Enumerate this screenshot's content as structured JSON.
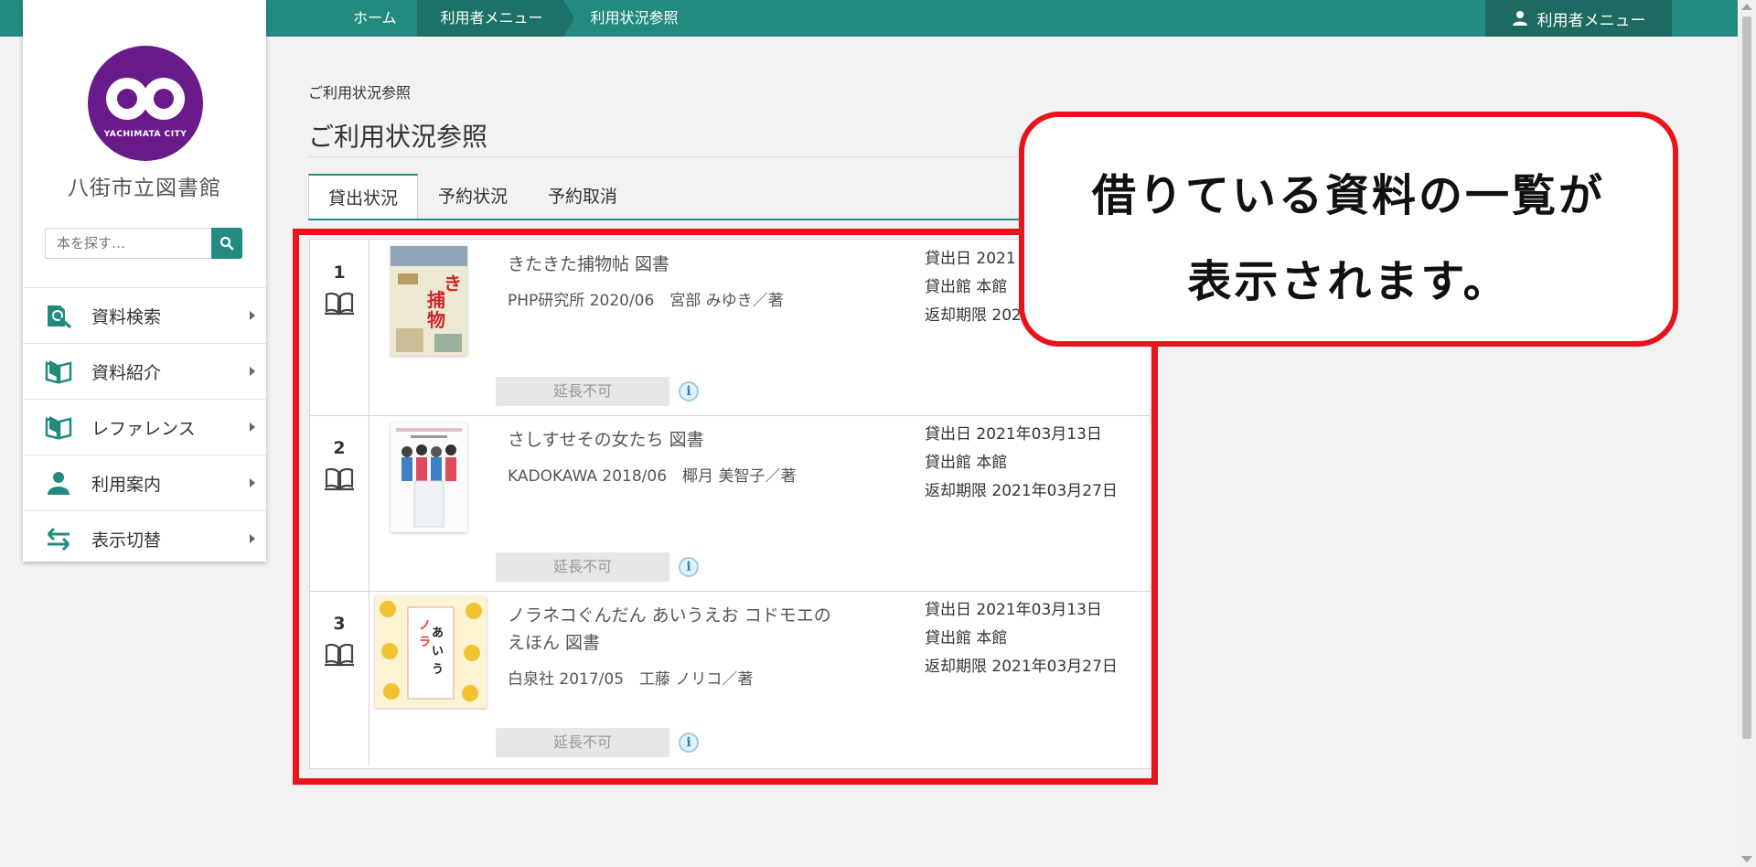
{
  "breadcrumb": [
    "ホーム",
    "利用者メニュー",
    "利用状況参照"
  ],
  "user_menu": {
    "label": "利用者メニュー",
    "icon": "user-icon"
  },
  "sidebar": {
    "logo_text": "YACHIMATA CITY",
    "library_name": "八街市立図書館",
    "search": {
      "placeholder": "本を探す…",
      "icon": "search-icon"
    },
    "items": [
      {
        "label": "資料検索",
        "icon": "book-search-icon"
      },
      {
        "label": "資料紹介",
        "icon": "open-book-icon"
      },
      {
        "label": "レファレンス",
        "icon": "open-book-icon"
      },
      {
        "label": "利用案内",
        "icon": "person-icon"
      },
      {
        "label": "表示切替",
        "icon": "switch-arrows-icon"
      }
    ]
  },
  "page": {
    "breadcrumb_small": "ご利用状況参照",
    "title": "ご利用状況参照",
    "tabs": [
      "貸出状況",
      "予約状況",
      "予約取消"
    ],
    "active_tab": "貸出状況"
  },
  "loans": [
    {
      "no": "1",
      "title": "きたきた捕物帖 図書",
      "meta": "PHP研究所 2020/06　宮部 みゆき／著",
      "loan_date": "貸出日 2021",
      "branch": "貸出館 本館",
      "due": "返却期限 202",
      "button": "延長不可",
      "info": "i"
    },
    {
      "no": "2",
      "title": "さしすせその女たち 図書",
      "meta": "KADOKAWA 2018/06　椰月 美智子／著",
      "loan_date": "貸出日 2021年03月13日",
      "branch": "貸出館 本館",
      "due": "返却期限 2021年03月27日",
      "button": "延長不可",
      "info": "i"
    },
    {
      "no": "3",
      "title_line1": "ノラネコぐんだん あいうえお コドモエの",
      "title_line2": "えほん 図書",
      "meta": "白泉社 2017/05　工藤 ノリコ／著",
      "loan_date": "貸出日 2021年03月13日",
      "branch": "貸出館 本館",
      "due": "返却期限 2021年03月27日",
      "button": "延長不可",
      "info": "i"
    }
  ],
  "callout": {
    "line1": "借りている資料の一覧が",
    "line2": "表示されます。"
  },
  "colors": {
    "accent": "#238a80",
    "highlight": "#e8141c",
    "logo": "#6a1b8a"
  }
}
